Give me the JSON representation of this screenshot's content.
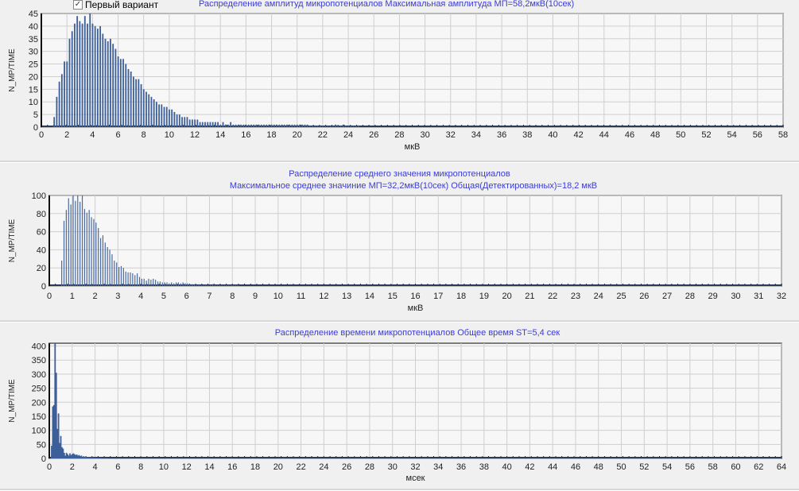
{
  "checkbox": {
    "label": "Первый вариант",
    "checked": true
  },
  "colors": {
    "bar": "#3d5f99",
    "bar_light": "#4a6aa0",
    "title": "#3b3bd6",
    "grid": "#cfcfcf"
  },
  "chart_data": [
    {
      "type": "bar",
      "title": "Распределение  амплитуд микропотенциалов   Максимальная амплитуда МП=58,2мкВ(10сек)",
      "xlabel": "мкВ",
      "ylabel": "N_MP/TIME",
      "xlim": [
        0,
        58
      ],
      "ylim": [
        0,
        45
      ],
      "xticks": [
        0,
        2,
        4,
        6,
        8,
        10,
        12,
        14,
        16,
        18,
        20,
        22,
        24,
        26,
        28,
        30,
        32,
        34,
        36,
        38,
        40,
        42,
        44,
        46,
        48,
        50,
        52,
        54,
        56,
        58
      ],
      "yticks": [
        0,
        5,
        10,
        15,
        20,
        25,
        30,
        35,
        40,
        45
      ],
      "x_start": 1.0,
      "x_step": 0.2,
      "values": [
        4,
        12,
        18,
        21,
        26,
        26,
        35,
        38,
        41,
        44,
        42,
        41,
        44,
        41,
        45,
        41,
        40,
        39,
        40,
        37,
        35,
        34,
        35,
        33,
        31,
        28,
        27,
        27,
        25,
        23,
        22,
        20,
        19,
        19,
        17,
        15,
        14,
        13,
        12,
        11,
        10,
        9,
        9,
        8,
        8,
        7,
        7,
        6,
        5,
        5,
        4,
        4,
        4,
        3,
        3,
        3,
        3,
        2,
        2,
        2,
        2,
        2,
        2,
        2,
        2,
        1,
        2,
        1,
        1,
        2,
        1,
        1,
        1,
        1,
        1,
        1,
        1,
        1,
        1,
        1,
        1,
        1,
        1,
        1,
        1,
        1,
        1,
        1,
        1,
        1,
        1,
        1,
        1,
        1,
        1,
        1,
        1,
        1,
        1,
        1,
        0.5,
        0.5,
        0.5,
        0.5,
        0.5,
        0.5,
        0.5,
        0.5,
        0.5,
        0.5,
        1,
        0.5,
        0.5,
        1,
        0.5,
        0.5,
        0.5,
        0.5,
        0.5,
        0.5
      ]
    },
    {
      "type": "bar",
      "title": "Распределение среднего значения микропотенциалов",
      "subtitle": "Максимальное среднее значиние МП=32,2мкВ(10сек)    Общая(Детектированных)=18,2 мкВ",
      "xlabel": "мкВ",
      "ylabel": "N_MP/TIME",
      "xlim": [
        0,
        32
      ],
      "ylim": [
        0,
        100
      ],
      "xticks": [
        0,
        1,
        2,
        3,
        4,
        5,
        6,
        7,
        8,
        9,
        10,
        11,
        12,
        13,
        14,
        15,
        16,
        17,
        18,
        19,
        20,
        21,
        22,
        23,
        24,
        25,
        26,
        27,
        28,
        29,
        30,
        31,
        32
      ],
      "yticks": [
        0,
        20,
        40,
        60,
        80,
        100
      ],
      "x_start": 0.55,
      "x_step": 0.1,
      "values": [
        28,
        72,
        84,
        97,
        90,
        100,
        94,
        100,
        93,
        100,
        85,
        81,
        84,
        76,
        74,
        70,
        64,
        53,
        56,
        48,
        43,
        40,
        35,
        28,
        26,
        21,
        22,
        20,
        16,
        15,
        15,
        14,
        12,
        14,
        10,
        8,
        8,
        6,
        8,
        7,
        8,
        7,
        5,
        5,
        4,
        4,
        4,
        3,
        4,
        3,
        4,
        4,
        3,
        4,
        3,
        3,
        2,
        2,
        2,
        1,
        2,
        1,
        1,
        2,
        1,
        1,
        2,
        1,
        1,
        1,
        1,
        1,
        1,
        1,
        1,
        1,
        1,
        1
      ]
    },
    {
      "type": "bar",
      "title": "Распределение времени микропотенциалов   Общее время ST=5,4 сек",
      "xlabel": "мсек",
      "ylabel": "N_MP/TIME",
      "xlim": [
        0,
        64
      ],
      "ylim": [
        0,
        410
      ],
      "xticks": [
        0,
        2,
        4,
        6,
        8,
        10,
        12,
        14,
        16,
        18,
        20,
        22,
        24,
        26,
        28,
        30,
        32,
        34,
        36,
        38,
        40,
        42,
        44,
        46,
        48,
        50,
        52,
        54,
        56,
        58,
        60,
        62,
        64
      ],
      "yticks": [
        0,
        50,
        100,
        150,
        200,
        250,
        300,
        350,
        400
      ],
      "x_start": 0.2,
      "x_step": 0.1,
      "values": [
        45,
        185,
        190,
        410,
        305,
        105,
        160,
        55,
        80,
        40,
        35,
        20,
        10,
        20,
        15,
        10,
        18,
        12,
        15,
        18,
        15,
        12,
        14,
        10,
        12,
        8,
        10,
        6,
        8,
        5,
        6,
        5,
        4,
        5,
        3,
        4,
        3,
        2,
        3,
        2,
        2,
        2,
        1,
        2,
        1,
        1,
        1,
        1,
        1,
        1
      ]
    }
  ]
}
